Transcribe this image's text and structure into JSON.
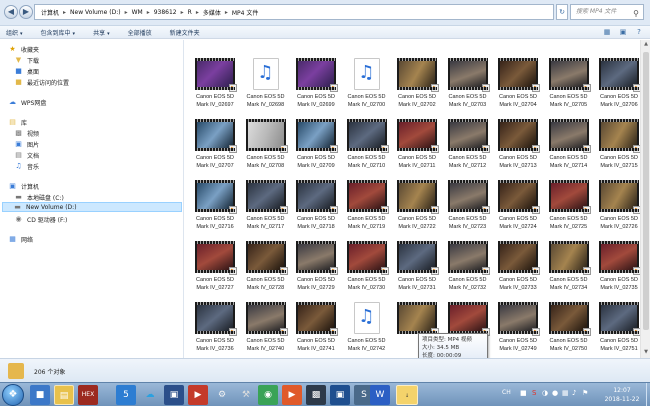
{
  "address": {
    "crumbs": [
      "计算机",
      "New Volume (D:)",
      "WM",
      "938612",
      "R",
      "多媒体",
      "MP4 文件"
    ],
    "search_placeholder": "搜索 MP4 文件"
  },
  "toolbar": {
    "organize": "组织",
    "include_in_library": "包含到库中",
    "share": "共享",
    "burn": "全部播放",
    "new_folder": "新建文件夹"
  },
  "sidebar": {
    "favorites": "收藏夹",
    "downloads": "下载",
    "desktop": "桌面",
    "recent": "最近访问的位置",
    "wps": "WPS网盘",
    "libraries": "库",
    "videos": "视频",
    "pictures": "图片",
    "documents": "文档",
    "music": "音乐",
    "computer": "计算机",
    "local_disk": "本地磁盘 (C:)",
    "new_volume": "New Volume (D:)",
    "cd_drive": "CD 驱动器 (F:)",
    "network": "网络"
  },
  "files": [
    {
      "name1": "Canon EOS 5D",
      "name2": "Mark IV_02697",
      "kind": "video",
      "scene": "s1"
    },
    {
      "name1": "Canon EOS 5D",
      "name2": "Mark IV_02698",
      "kind": "doc",
      "scene": ""
    },
    {
      "name1": "Canon EOS 5D",
      "name2": "Mark IV_02699",
      "kind": "video",
      "scene": "s1"
    },
    {
      "name1": "Canon EOS 5D",
      "name2": "Mark IV_02700",
      "kind": "doc",
      "scene": ""
    },
    {
      "name1": "Canon EOS 5D",
      "name2": "Mark IV_02702",
      "kind": "video",
      "scene": "s3"
    },
    {
      "name1": "Canon EOS 5D",
      "name2": "Mark IV_02703",
      "kind": "video",
      "scene": "s2"
    },
    {
      "name1": "Canon EOS 5D",
      "name2": "Mark IV_02704",
      "kind": "video",
      "scene": "s8"
    },
    {
      "name1": "Canon EOS 5D",
      "name2": "Mark IV_02705",
      "kind": "video",
      "scene": "s2"
    },
    {
      "name1": "Canon EOS 5D",
      "name2": "Mark IV_02706",
      "kind": "video",
      "scene": "s4"
    },
    {
      "name1": "Canon EOS 5D",
      "name2": "Mark IV_02707",
      "kind": "video",
      "scene": "s6"
    },
    {
      "name1": "Canon EOS 5D",
      "name2": "Mark IV_02708",
      "kind": "video",
      "scene": "s7"
    },
    {
      "name1": "Canon EOS 5D",
      "name2": "Mark IV_02709",
      "kind": "video",
      "scene": "s6"
    },
    {
      "name1": "Canon EOS 5D",
      "name2": "Mark IV_02710",
      "kind": "video",
      "scene": "s4"
    },
    {
      "name1": "Canon EOS 5D",
      "name2": "Mark IV_02711",
      "kind": "video",
      "scene": "s5"
    },
    {
      "name1": "Canon EOS 5D",
      "name2": "Mark IV_02712",
      "kind": "video",
      "scene": "s2"
    },
    {
      "name1": "Canon EOS 5D",
      "name2": "Mark IV_02713",
      "kind": "video",
      "scene": "s8"
    },
    {
      "name1": "Canon EOS 5D",
      "name2": "Mark IV_02714",
      "kind": "video",
      "scene": "s2"
    },
    {
      "name1": "Canon EOS 5D",
      "name2": "Mark IV_02715",
      "kind": "video",
      "scene": "s3"
    },
    {
      "name1": "Canon EOS 5D",
      "name2": "Mark IV_02716",
      "kind": "video",
      "scene": "s6"
    },
    {
      "name1": "Canon EOS 5D",
      "name2": "Mark IV_02717",
      "kind": "video",
      "scene": "s4"
    },
    {
      "name1": "Canon EOS 5D",
      "name2": "Mark IV_02718",
      "kind": "video",
      "scene": "s4"
    },
    {
      "name1": "Canon EOS 5D",
      "name2": "Mark IV_02719",
      "kind": "video",
      "scene": "s5"
    },
    {
      "name1": "Canon EOS 5D",
      "name2": "Mark IV_02722",
      "kind": "video",
      "scene": "s3"
    },
    {
      "name1": "Canon EOS 5D",
      "name2": "Mark IV_02723",
      "kind": "video",
      "scene": "s2"
    },
    {
      "name1": "Canon EOS 5D",
      "name2": "Mark IV_02724",
      "kind": "video",
      "scene": "s8"
    },
    {
      "name1": "Canon EOS 5D",
      "name2": "Mark IV_02725",
      "kind": "video",
      "scene": "s5"
    },
    {
      "name1": "Canon EOS 5D",
      "name2": "Mark IV_02726",
      "kind": "video",
      "scene": "s3"
    },
    {
      "name1": "Canon EOS 5D",
      "name2": "Mark IV_02727",
      "kind": "video",
      "scene": "s5"
    },
    {
      "name1": "Canon EOS 5D",
      "name2": "Mark IV_02728",
      "kind": "video",
      "scene": "s8"
    },
    {
      "name1": "Canon EOS 5D",
      "name2": "Mark IV_02729",
      "kind": "video",
      "scene": "s2"
    },
    {
      "name1": "Canon EOS 5D",
      "name2": "Mark IV_02730",
      "kind": "video",
      "scene": "s5"
    },
    {
      "name1": "Canon EOS 5D",
      "name2": "Mark IV_02731",
      "kind": "video",
      "scene": "s4"
    },
    {
      "name1": "Canon EOS 5D",
      "name2": "Mark IV_02732",
      "kind": "video",
      "scene": "s2"
    },
    {
      "name1": "Canon EOS 5D",
      "name2": "Mark IV_02733",
      "kind": "video",
      "scene": "s8"
    },
    {
      "name1": "Canon EOS 5D",
      "name2": "Mark IV_02734",
      "kind": "video",
      "scene": "s3"
    },
    {
      "name1": "Canon EOS 5D",
      "name2": "Mark IV_02735",
      "kind": "video",
      "scene": "s5"
    },
    {
      "name1": "Canon EOS 5D",
      "name2": "Mark IV_02736",
      "kind": "video",
      "scene": "s4"
    },
    {
      "name1": "Canon EOS 5D",
      "name2": "Mark IV_02740",
      "kind": "video",
      "scene": "s2"
    },
    {
      "name1": "Canon EOS 5D",
      "name2": "Mark IV_02741",
      "kind": "video",
      "scene": "s8"
    },
    {
      "name1": "Canon EOS 5D",
      "name2": "Mark IV_02742",
      "kind": "doc",
      "scene": ""
    },
    {
      "name1": "",
      "name2": "",
      "kind": "video",
      "scene": "s3"
    },
    {
      "name1": "Canon EOS 5D",
      "name2": "Mark IV_02745",
      "kind": "video",
      "scene": "s5"
    },
    {
      "name1": "Canon EOS 5D",
      "name2": "Mark IV_02749",
      "kind": "video",
      "scene": "s2"
    },
    {
      "name1": "Canon EOS 5D",
      "name2": "Mark IV_02750",
      "kind": "video",
      "scene": "s8"
    },
    {
      "name1": "Canon EOS 5D",
      "name2": "Mark IV_02751",
      "kind": "video",
      "scene": "s4"
    }
  ],
  "tooltip": {
    "line1": "项目类型: MP4 视频",
    "line2": "大小: 34.5 MB",
    "line3": "长度: 00:00:09"
  },
  "details": {
    "count": "206 个对象"
  },
  "taskbar": {
    "clock_time": "12:07",
    "clock_date": "2018-11-22",
    "tray_lang": "CH"
  }
}
